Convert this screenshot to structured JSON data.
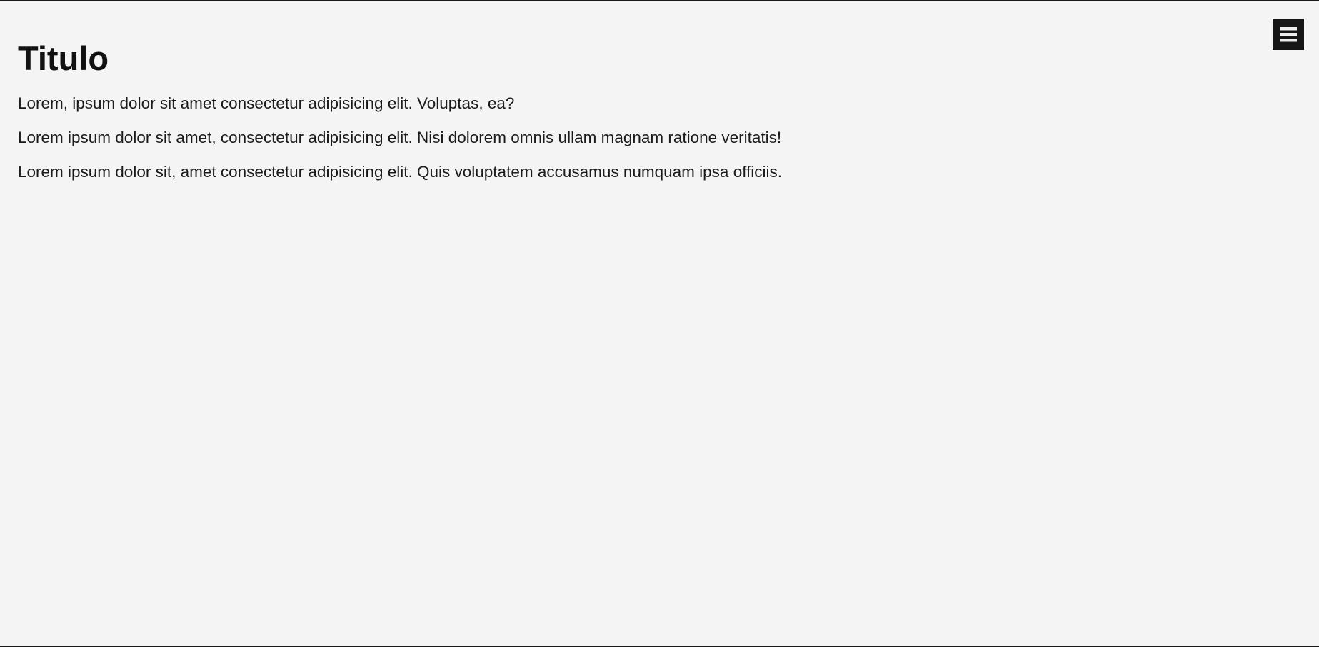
{
  "header": {
    "menu_icon": "hamburger-menu-icon"
  },
  "main": {
    "title": "Titulo",
    "paragraphs": [
      "Lorem, ipsum dolor sit amet consectetur adipisicing elit. Voluptas, ea?",
      "Lorem ipsum dolor sit amet, consectetur adipisicing elit. Nisi dolorem omnis ullam magnam ratione veritatis!",
      "Lorem ipsum dolor sit, amet consectetur adipisicing elit. Quis voluptatem accusamus numquam ipsa officiis."
    ]
  },
  "colors": {
    "background": "#f4f4f4",
    "menu_button": "#161616",
    "text": "#161616"
  }
}
